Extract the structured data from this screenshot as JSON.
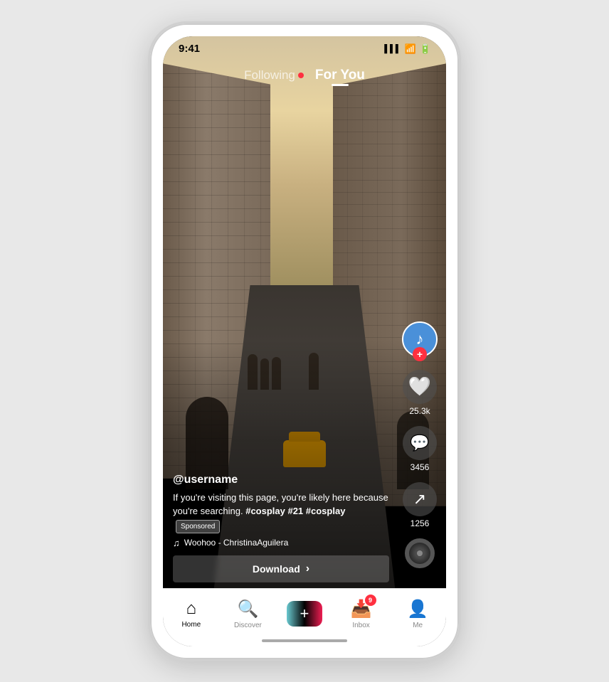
{
  "phone": {
    "status_bar": {
      "time": "9:41",
      "signal": "▌▌▌",
      "wifi": "WiFi",
      "battery": "Battery"
    }
  },
  "top_nav": {
    "following_label": "Following",
    "for_you_label": "For You",
    "live_dot_visible": true
  },
  "video": {
    "username": "@username",
    "caption": "If you're visiting this page, you're likely here because you're searching.",
    "hashtags": "#cosplay #21 #cosplay",
    "sponsored_label": "Sponsored",
    "music": "Woohoo - ChristinaAguilera",
    "download_label": "Download"
  },
  "actions": {
    "likes_count": "25.3k",
    "comments_count": "3456",
    "shares_count": "1256",
    "plus_label": "+"
  },
  "bottom_nav": {
    "home_label": "Home",
    "discover_label": "Discover",
    "plus_label": "+",
    "inbox_label": "Inbox",
    "inbox_badge": "9",
    "me_label": "Me"
  }
}
